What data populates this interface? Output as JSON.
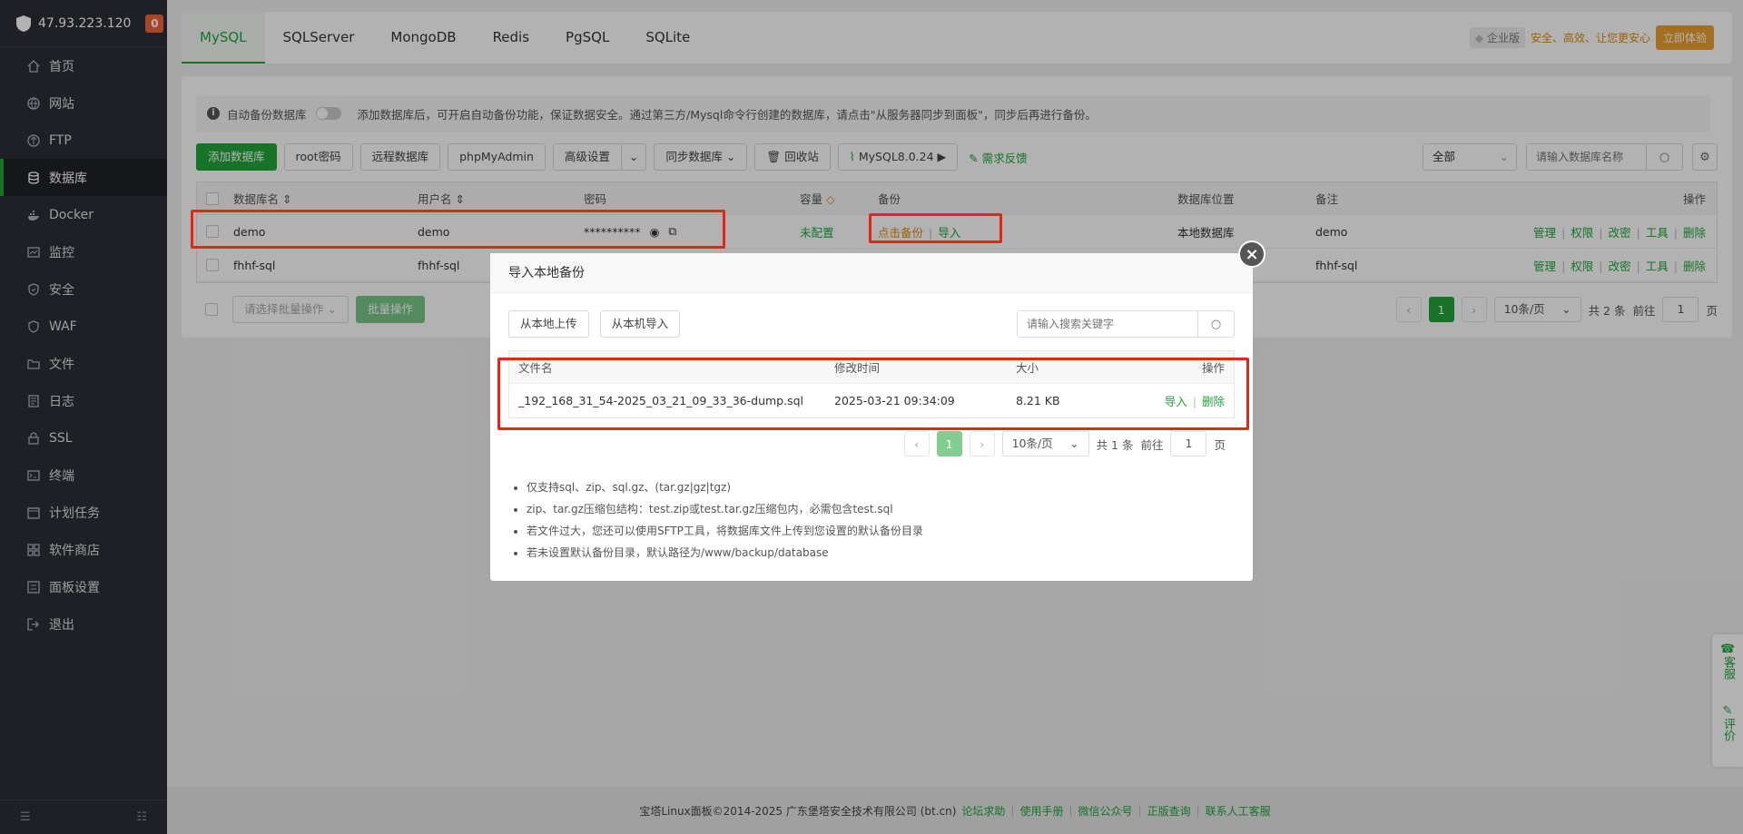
{
  "sidebar": {
    "ip": "47.93.223.120",
    "badge": "0",
    "items": [
      {
        "label": "首页",
        "icon": "home-icon"
      },
      {
        "label": "网站",
        "icon": "globe-icon"
      },
      {
        "label": "FTP",
        "icon": "ftp-icon"
      },
      {
        "label": "数据库",
        "icon": "database-icon",
        "active": true
      },
      {
        "label": "Docker",
        "icon": "docker-icon"
      },
      {
        "label": "监控",
        "icon": "monitor-icon"
      },
      {
        "label": "安全",
        "icon": "shield-icon"
      },
      {
        "label": "WAF",
        "icon": "waf-icon"
      },
      {
        "label": "文件",
        "icon": "folder-icon"
      },
      {
        "label": "日志",
        "icon": "log-icon"
      },
      {
        "label": "SSL",
        "icon": "ssl-icon"
      },
      {
        "label": "终端",
        "icon": "terminal-icon"
      },
      {
        "label": "计划任务",
        "icon": "calendar-icon"
      },
      {
        "label": "软件商店",
        "icon": "store-icon"
      },
      {
        "label": "面板设置",
        "icon": "settings-icon"
      },
      {
        "label": "退出",
        "icon": "logout-icon"
      }
    ]
  },
  "tabs": [
    "MySQL",
    "SQLServer",
    "MongoDB",
    "Redis",
    "PgSQL",
    "SQLite"
  ],
  "promo": {
    "edition": "企业版",
    "text": "安全、高效、让您更安心",
    "button": "立即体验"
  },
  "tip": {
    "label": "自动备份数据库",
    "text": "添加数据库后，可开启自动备份功能，保证数据安全。通过第三方/Mysql命令行创建的数据库，请点击\"从服务器同步到面板\"，同步后再进行备份。"
  },
  "toolbar": {
    "add": "添加数据库",
    "root_pw": "root密码",
    "remote": "远程数据库",
    "pma": "phpMyAdmin",
    "advanced": "高级设置",
    "sync": "同步数据库",
    "recycle": "回收站",
    "version": "MySQL8.0.24 ▶",
    "feedback": "需求反馈",
    "filter": "全部",
    "search_placeholder": "请输入数据库名称"
  },
  "table": {
    "headers": {
      "name": "数据库名",
      "user": "用户名",
      "password": "密码",
      "capacity": "容量",
      "backup": "备份",
      "location": "数据库位置",
      "note": "备注",
      "ops": "操作"
    },
    "rows": [
      {
        "name": "demo",
        "user": "demo",
        "password": "**********",
        "capacity": "未配置",
        "backup": "点击备份",
        "import": "导入",
        "location": "本地数据库",
        "note": "demo"
      },
      {
        "name": "fhhf-sql",
        "user": "fhhf-sql",
        "password": "",
        "capacity": "",
        "backup": "",
        "import": "",
        "location": "",
        "note": "fhhf-sql"
      }
    ],
    "ops": [
      "管理",
      "权限",
      "改密",
      "工具",
      "删除"
    ]
  },
  "bulk": {
    "placeholder": "请选择批量操作",
    "button": "批量操作"
  },
  "pagination": {
    "current": "1",
    "per_page": "10条/页",
    "total": "共 2 条",
    "goto": "前往",
    "page_input": "1",
    "page_unit": "页"
  },
  "dialog": {
    "title": "导入本地备份",
    "btn_upload": "从本地上传",
    "btn_import": "从本机导入",
    "search_placeholder": "请输入搜索关键字",
    "headers": {
      "name": "文件名",
      "time": "修改时间",
      "size": "大小",
      "ops": "操作"
    },
    "files": [
      {
        "name": "_192_168_31_54-2025_03_21_09_33_36-dump.sql",
        "time": "2025-03-21 09:34:09",
        "size": "8.21 KB",
        "import": "导入",
        "delete": "删除"
      }
    ],
    "pagination": {
      "current": "1",
      "per_page": "10条/页",
      "total": "共 1 条",
      "goto": "前往",
      "page_input": "1",
      "page_unit": "页"
    },
    "notes": [
      "仅支持sql、zip、sql.gz、(tar.gz|gz|tgz)",
      "zip、tar.gz压缩包结构：test.zip或test.tar.gz压缩包内，必需包含test.sql",
      "若文件过大，您还可以使用SFTP工具，将数据库文件上传到您设置的默认备份目录",
      "若未设置默认备份目录，默认路径为/www/backup/database"
    ]
  },
  "footer": {
    "copyright": "宝塔Linux面板©2014-2025 广东堡塔安全技术有限公司 (bt.cn)",
    "links": [
      "论坛求助",
      "使用手册",
      "微信公众号",
      "正版查询",
      "联系人工客服"
    ]
  },
  "floater": {
    "service": "客服",
    "review": "评价"
  },
  "colors": {
    "accent": "#20a53a",
    "sidebar_bg": "#2b2f36",
    "highlight": "#e8231a",
    "warning": "#e08a14"
  }
}
